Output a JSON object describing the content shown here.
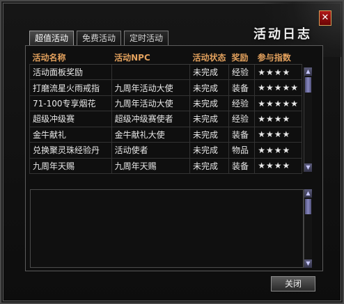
{
  "window": {
    "title": "活动日志",
    "close_glyph": "✕"
  },
  "tabs": [
    {
      "label": "超值活动",
      "active": true
    },
    {
      "label": "免费活动",
      "active": false
    },
    {
      "label": "定时活动",
      "active": false
    }
  ],
  "table": {
    "columns": [
      "活动名称",
      "活动NPC",
      "活动状态",
      "奖励",
      "参与指数"
    ],
    "rows": [
      {
        "name": "活动面板奖励",
        "npc": "",
        "status": "未完成",
        "reward": "经验",
        "stars": "★★★★"
      },
      {
        "name": "打磨流星火雨戒指",
        "npc": "九周年活动大使",
        "status": "未完成",
        "reward": "装备",
        "stars": "★★★★★"
      },
      {
        "name": "71-100专享烟花",
        "npc": "九周年活动大使",
        "status": "未完成",
        "reward": "经验",
        "stars": "★★★★★"
      },
      {
        "name": "超级冲级赛",
        "npc": "超级冲级赛使者",
        "status": "未完成",
        "reward": "经验",
        "stars": "★★★★"
      },
      {
        "name": "金牛献礼",
        "npc": "金牛献礼大使",
        "status": "未完成",
        "reward": "装备",
        "stars": "★★★★"
      },
      {
        "name": "兑换聚灵珠经验丹",
        "npc": "活动使者",
        "status": "未完成",
        "reward": "物品",
        "stars": "★★★★"
      },
      {
        "name": "九周年天赐",
        "npc": "九周年天赐",
        "status": "未完成",
        "reward": "装备",
        "stars": "★★★★"
      }
    ]
  },
  "scrollbar": {
    "up_glyph": "▲",
    "down_glyph": "▼"
  },
  "footer": {
    "close_label": "关闭"
  },
  "colors": {
    "header": "#e3a15d",
    "close_red": "#b01818"
  }
}
